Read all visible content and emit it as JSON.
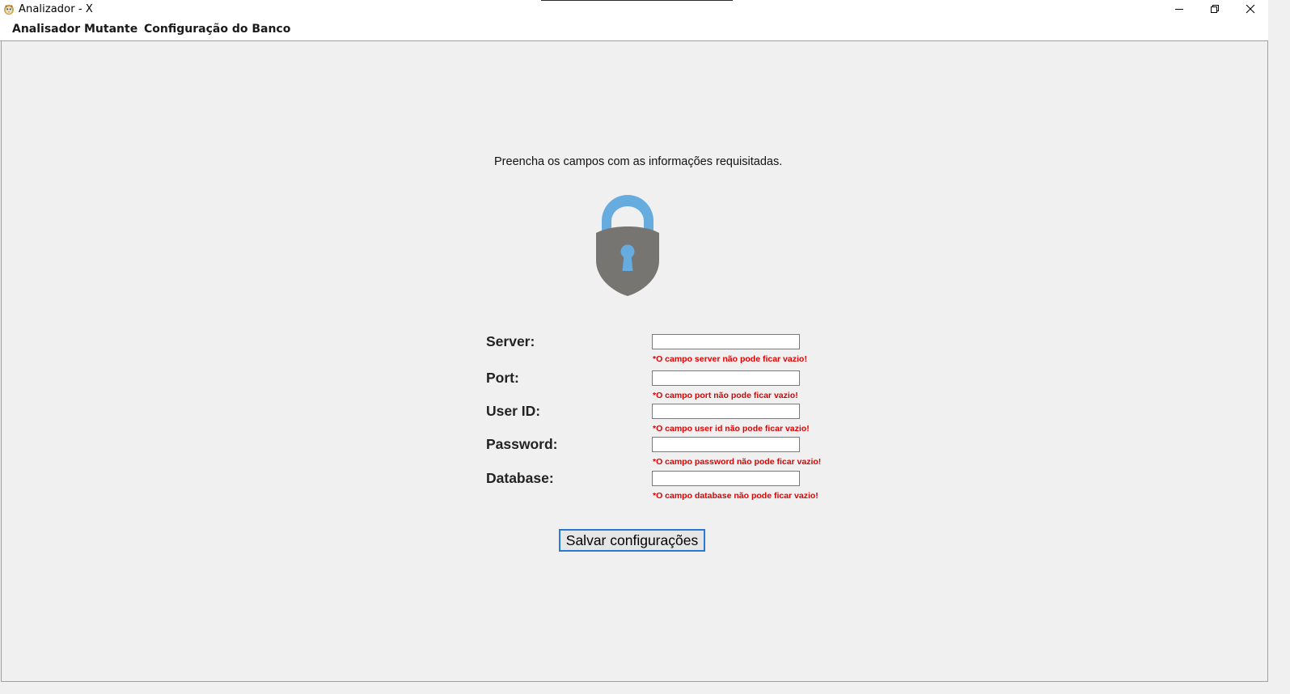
{
  "window": {
    "title": "Analizador - X",
    "minimize_icon": "minimize-icon",
    "restore_icon": "restore-icon",
    "close_icon": "close-icon"
  },
  "menu": {
    "items": [
      {
        "label": "Analisador"
      },
      {
        "label": "Mutante"
      },
      {
        "label": "Configuração do Banco"
      }
    ]
  },
  "form": {
    "instructions": "Preencha os campos com as informações requisitadas.",
    "icon": "lock-icon",
    "fields": [
      {
        "label": "Server:",
        "value": "",
        "error": "*O campo server não pode ficar vazio!"
      },
      {
        "label": "Port:",
        "value": "",
        "error": "*O campo port não pode ficar vazio!"
      },
      {
        "label": "User ID:",
        "value": "",
        "error": "*O campo user id não pode ficar vazio!"
      },
      {
        "label": "Password:",
        "value": "",
        "error": "*O campo password não pode ficar vazio!"
      },
      {
        "label": "Database:",
        "value": "",
        "error": "*O campo database não pode ficar vazio!"
      }
    ],
    "save_label": "Salvar configurações"
  },
  "colors": {
    "error": "#e00000",
    "lock_body": "#767571",
    "lock_shackle": "#66acde",
    "button_focus_border": "#2a7ad2",
    "background": "#f0f0f0"
  }
}
